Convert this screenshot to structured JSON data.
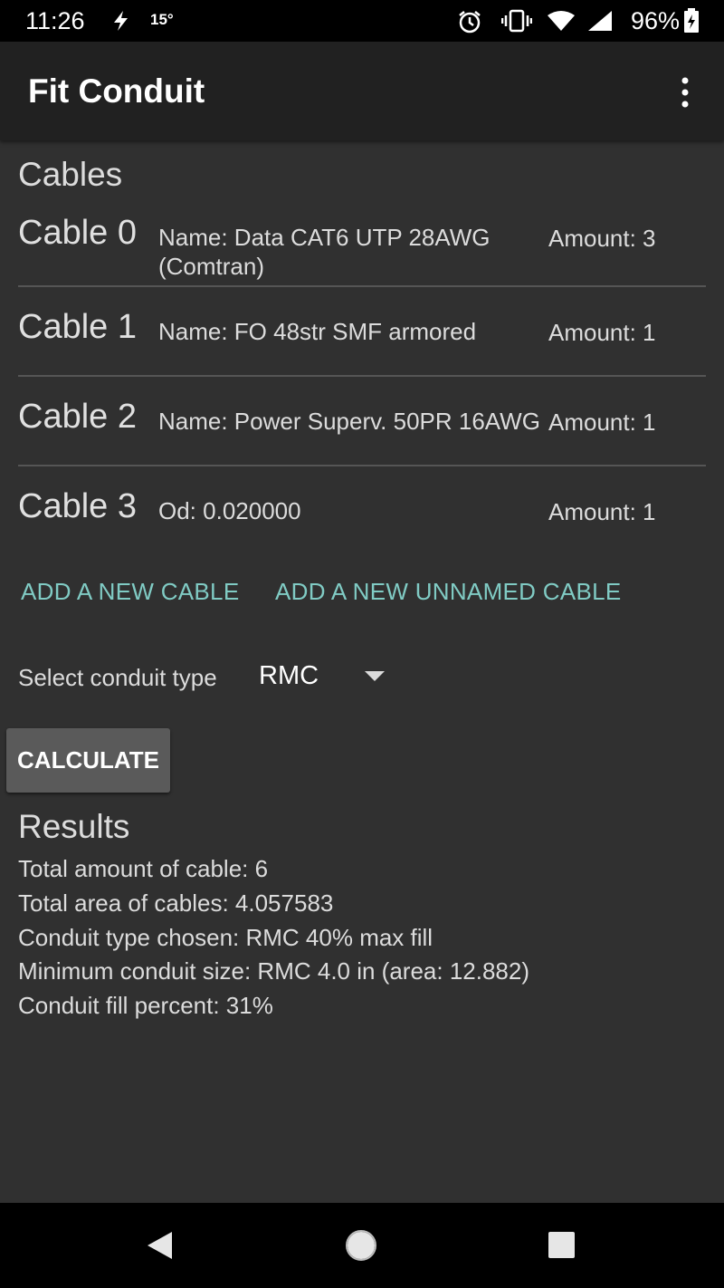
{
  "status_bar": {
    "time": "11:26",
    "temperature": "15°",
    "battery_percent": "96%"
  },
  "app_bar": {
    "title": "Fit Conduit"
  },
  "cables_section": {
    "title": "Cables",
    "items": [
      {
        "index_label": "Cable 0",
        "description": "Name: Data CAT6 UTP 28AWG (Comtran)",
        "amount": "Amount: 3"
      },
      {
        "index_label": "Cable 1",
        "description": "Name: FO 48str SMF armored",
        "amount": "Amount: 1"
      },
      {
        "index_label": "Cable 2",
        "description": "Name: Power Superv. 50PR 16AWG",
        "amount": "Amount: 1"
      },
      {
        "index_label": "Cable 3",
        "description": "Od: 0.020000",
        "amount": "Amount: 1"
      }
    ]
  },
  "actions": {
    "add_cable": "ADD A NEW CABLE",
    "add_unnamed_cable": "ADD A NEW UNNAMED CABLE"
  },
  "conduit_select": {
    "label": "Select conduit type",
    "value": "RMC"
  },
  "calculate_button": "CALCULATE",
  "results": {
    "title": "Results",
    "lines": [
      "Total amount of cable: 6",
      "Total area of cables: 4.057583",
      "Conduit type chosen: RMC 40% max fill",
      "Minimum conduit size: RMC 4.0 in (area: 12.882)",
      "Conduit fill percent: 31%"
    ]
  },
  "colors": {
    "background": "#303030",
    "app_bar": "#212121",
    "accent": "#80cbc4",
    "button": "#5a5a5a"
  }
}
